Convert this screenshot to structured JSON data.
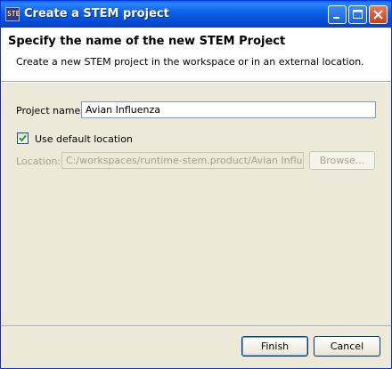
{
  "window": {
    "title": "Create a STEM project",
    "icon_text": "STE",
    "controls": [
      "minimize-icon",
      "maximize-icon",
      "close-icon"
    ]
  },
  "header": {
    "title": "Specify the name of the new STEM Project",
    "description": "Create a new STEM project in the workspace or in an external location."
  },
  "form": {
    "project_name_label": "Project name:",
    "project_name_value": "Avian Influenza",
    "use_default_label": "Use default location",
    "use_default_checked": true,
    "location_label": "Location:",
    "location_value": "C:/workspaces/runtime-stem.product/Avian Influenza",
    "browse_label": "Browse..."
  },
  "footer": {
    "finish_label": "Finish",
    "cancel_label": "Cancel"
  }
}
